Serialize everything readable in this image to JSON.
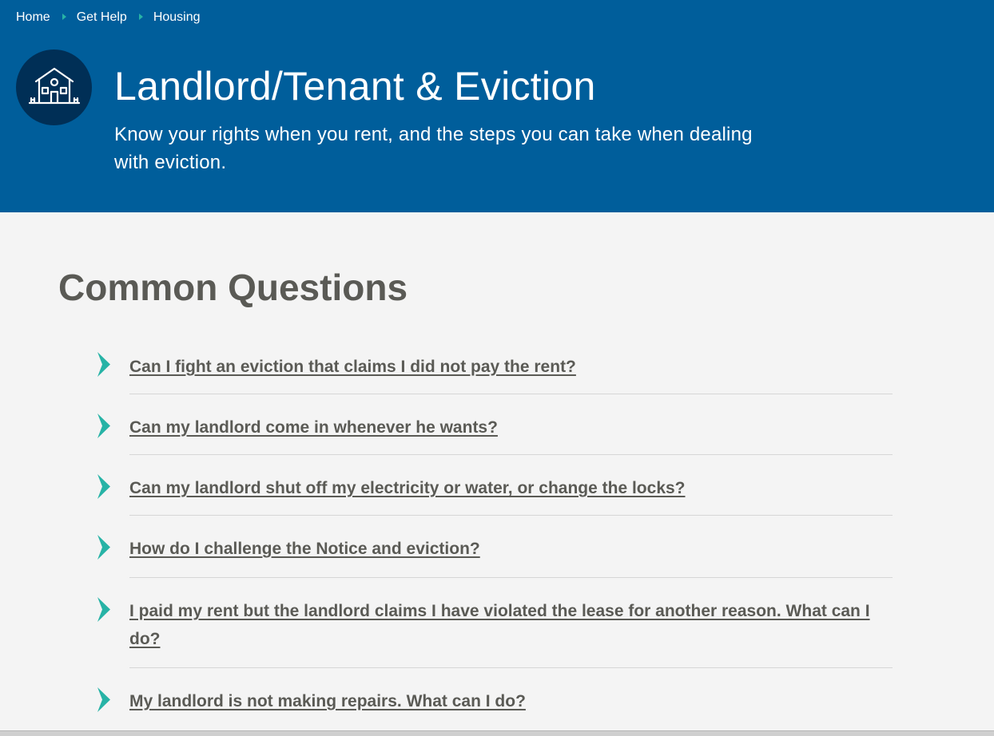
{
  "colors": {
    "hero_bg": "#005e9b",
    "icon_circle": "#002f56",
    "accent": "#27b3a6",
    "heading_text": "#5a5a55",
    "page_bg": "#f4f4f4"
  },
  "breadcrumb": {
    "items": [
      {
        "label": "Home"
      },
      {
        "label": "Get Help"
      },
      {
        "label": "Housing"
      }
    ],
    "separator_icon": "chevron-right-icon"
  },
  "hero": {
    "icon": "house-icon",
    "title": "Landlord/Tenant & Eviction",
    "subtitle": "Know your rights when you rent, and the steps you can take when dealing with eviction."
  },
  "faq": {
    "heading": "Common Questions",
    "bullet_icon": "chevron-bullet-icon",
    "questions": [
      {
        "text": "Can I fight an eviction that claims I did not pay the rent?"
      },
      {
        "text": "Can my landlord come in whenever he wants?"
      },
      {
        "text": "Can my landlord shut off my electricity or water, or change the locks?"
      },
      {
        "text": "How do I challenge the Notice and eviction?"
      },
      {
        "text": "I paid my rent but the landlord claims I have violated the lease for another reason. What can I do?"
      },
      {
        "text": "My landlord is not making repairs. What can I do?"
      }
    ]
  }
}
